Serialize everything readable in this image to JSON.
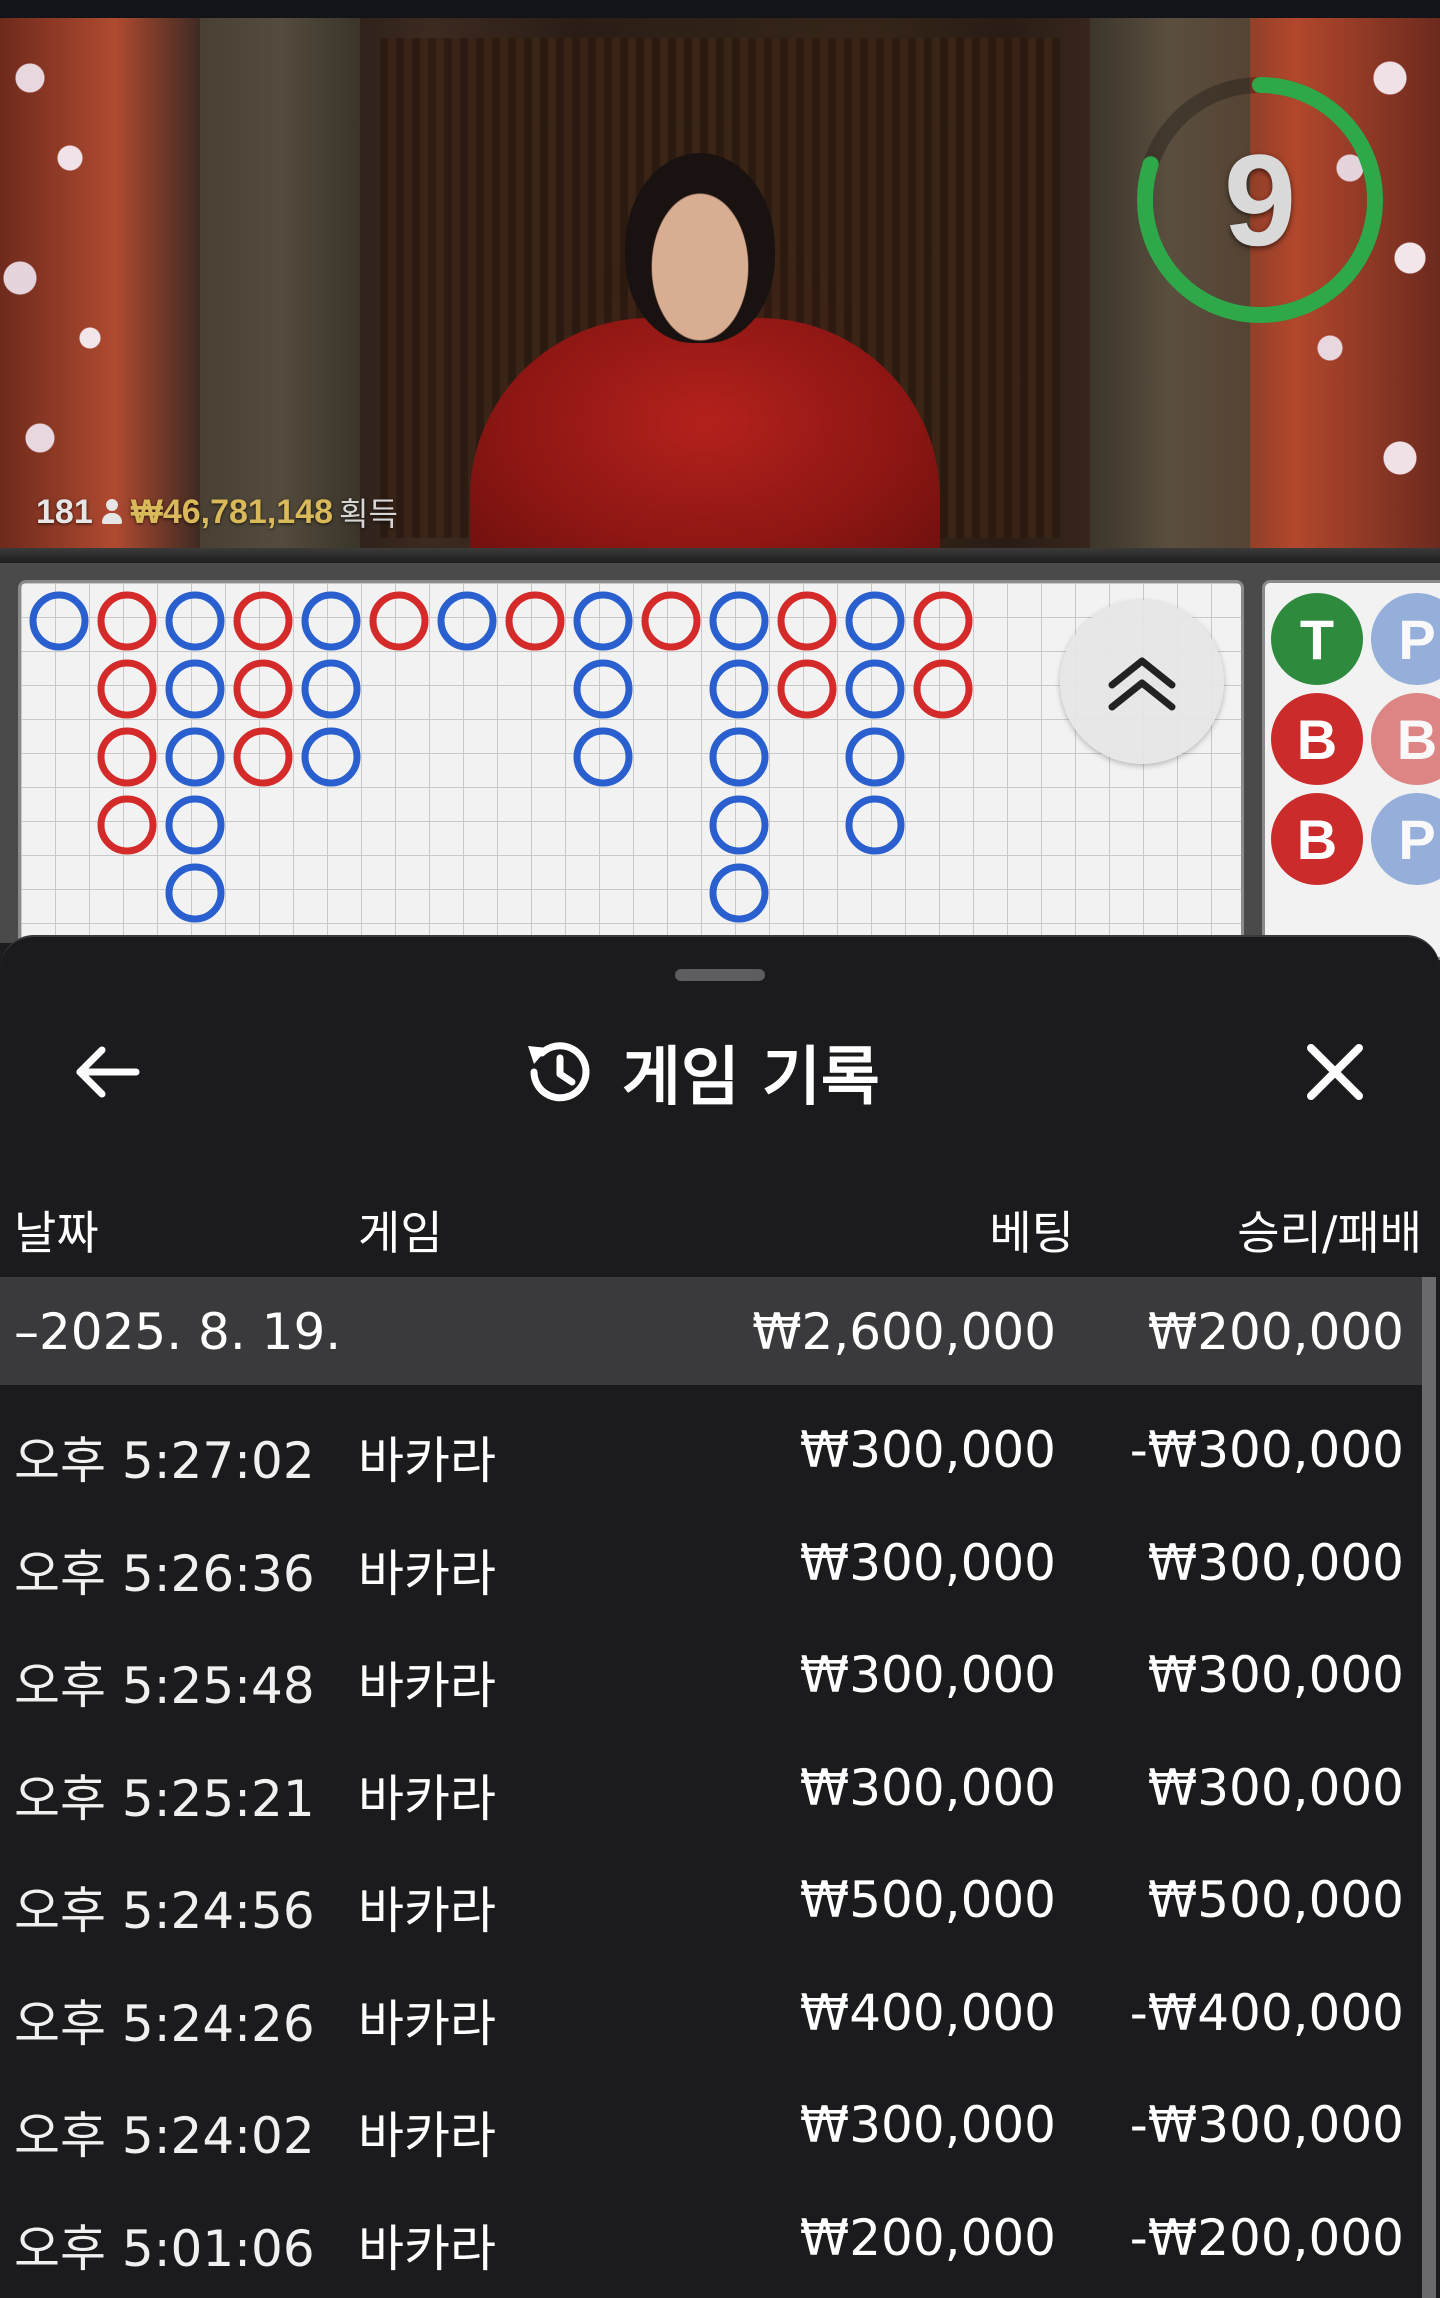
{
  "video": {
    "timer": "9",
    "timer_progress": 0.8,
    "player_count": "181",
    "won_amount": "₩46,781,148",
    "won_label": "획득"
  },
  "roadmap": {
    "side_chips": [
      {
        "label": "T",
        "color": "#2e8b3e"
      },
      {
        "label": "P",
        "color": "#4a78c8"
      },
      {
        "label": "B",
        "color": "#cc2b2b"
      },
      {
        "label": "B",
        "color": "#cc2b2b"
      },
      {
        "label": "B",
        "color": "#cc2b2b"
      },
      {
        "label": "P",
        "color": "#4a78c8"
      }
    ]
  },
  "history": {
    "title": "게임 기록",
    "columns": {
      "date": "날짜",
      "game": "게임",
      "bet": "베팅",
      "win_loss": "승리/패배"
    },
    "day": {
      "date": "–2025. 8. 19.",
      "bet": "₩2,600,000",
      "win_loss": "₩200,000"
    },
    "rows": [
      {
        "time": "오후 5:27:02",
        "game": "바카라",
        "bet": "₩300,000",
        "win_loss": "-₩300,000"
      },
      {
        "time": "오후 5:26:36",
        "game": "바카라",
        "bet": "₩300,000",
        "win_loss": "₩300,000"
      },
      {
        "time": "오후 5:25:48",
        "game": "바카라",
        "bet": "₩300,000",
        "win_loss": "₩300,000"
      },
      {
        "time": "오후 5:25:21",
        "game": "바카라",
        "bet": "₩300,000",
        "win_loss": "₩300,000"
      },
      {
        "time": "오후 5:24:56",
        "game": "바카라",
        "bet": "₩500,000",
        "win_loss": "₩500,000"
      },
      {
        "time": "오후 5:24:26",
        "game": "바카라",
        "bet": "₩400,000",
        "win_loss": "-₩400,000"
      },
      {
        "time": "오후 5:24:02",
        "game": "바카라",
        "bet": "₩300,000",
        "win_loss": "-₩300,000"
      },
      {
        "time": "오후 5:01:06",
        "game": "바카라",
        "bet": "₩200,000",
        "win_loss": "-₩200,000"
      }
    ]
  },
  "colors": {
    "banker": "#d42a2a",
    "player": "#2a5fd0",
    "tie": "#2e8b3e",
    "accent_gold": "#d9b95a",
    "timer_green": "#2fa84a"
  }
}
